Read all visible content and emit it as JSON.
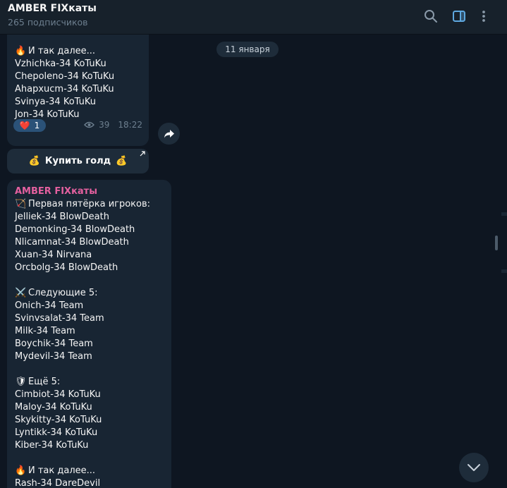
{
  "header": {
    "title": "AMBER FIXкаты",
    "subscribers": "265 подписчиков",
    "icons": [
      "search-icon",
      "sidebar-toggle-icon",
      "more-vertical-icon"
    ],
    "accent_color": "#5ea8e0"
  },
  "date_separator": "11 января",
  "message1": {
    "lines": [
      {
        "emoji": "🔥",
        "text": "И так далее..."
      },
      {
        "text": "Vzhichka-34 KoTuKu"
      },
      {
        "text": "Chepoleno-34 KoTuKu"
      },
      {
        "text": "Ahapxucm-34 KoTuKu"
      },
      {
        "text": "Svinya-34 KoTuKu"
      },
      {
        "text": "Jon-34 KoTuKu"
      }
    ],
    "reaction": {
      "emoji": "❤️",
      "count": "1"
    },
    "views": "39",
    "time": "18:22",
    "button_label": "Купить голд",
    "button_emoji": "💰"
  },
  "message2": {
    "author": "AMBER FIXкаты",
    "lines": [
      {
        "emoji": "🏹",
        "text": "Первая пятёрка игроков:"
      },
      {
        "text": "Jelliek-34 BlowDeath"
      },
      {
        "text": "Demonking-34 BlowDeath"
      },
      {
        "text": "Nlicamnat-34 BlowDeath"
      },
      {
        "text": "Xuan-34 Nirvana"
      },
      {
        "text": "Orcbolg-34 BlowDeath"
      },
      {
        "text": ""
      },
      {
        "emoji": "⚔️",
        "text": "Следующие 5:"
      },
      {
        "text": "Onich-34 Team"
      },
      {
        "text": "Svinvsalat-34 Team"
      },
      {
        "text": "Milk-34 Team"
      },
      {
        "text": "Boychik-34 Team"
      },
      {
        "text": "Mydevil-34 Team"
      },
      {
        "text": ""
      },
      {
        "emoji": "🛡",
        "text": "Ещё 5:"
      },
      {
        "text": "Cimbiot-34 KoTuKu"
      },
      {
        "text": "Maloy-34 KoTuKu"
      },
      {
        "text": "Skykitty-34 KoTuKu"
      },
      {
        "text": "Lyntikk-34 KoTuKu"
      },
      {
        "text": "Kiber-34 KoTuKu"
      },
      {
        "text": ""
      },
      {
        "emoji": "🔥",
        "text": "И так далее..."
      },
      {
        "text": "Rash-34 DareDevil"
      }
    ]
  }
}
